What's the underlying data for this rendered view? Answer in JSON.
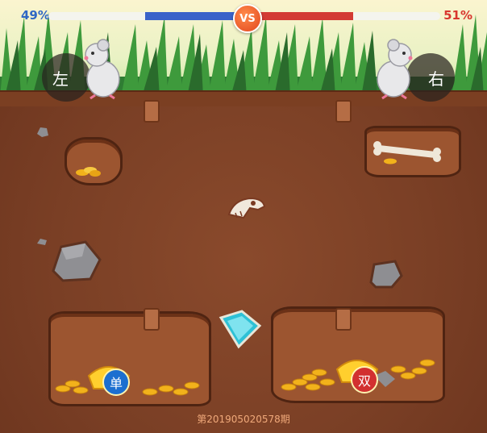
{
  "scoreboard": {
    "left_percent": "49%",
    "right_percent": "51%",
    "left_share": 0.49,
    "right_share": 0.51,
    "vs_label": "VS",
    "left_color": "#3a62c9",
    "right_color": "#d33a34"
  },
  "bets": {
    "left_label": "左",
    "right_label": "右",
    "odd_label": "单",
    "even_label": "双"
  },
  "icons": [
    "mouse-icon",
    "down-arrow-icon",
    "bone-icon",
    "dino-skull-icon",
    "diamond-icon",
    "gold-coins-icon",
    "gold-ingot-icon",
    "rock-icon"
  ],
  "period_text": "第201905020578期"
}
